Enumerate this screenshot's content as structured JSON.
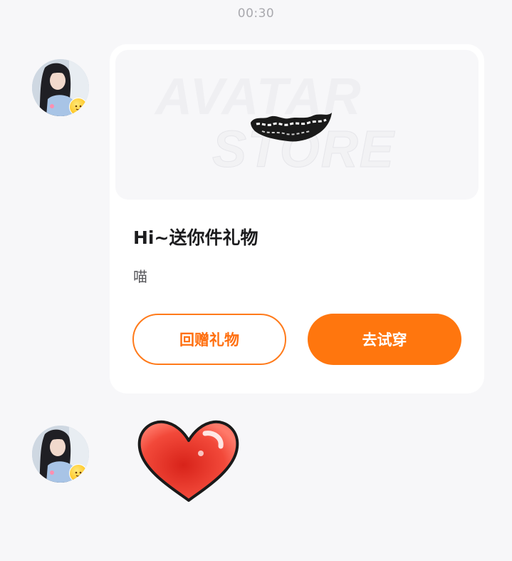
{
  "chat": {
    "timestamp": "00:30"
  },
  "gift_card": {
    "banner_watermark_line1": "AVATAR",
    "banner_watermark_line2": "STORE",
    "banner_item_icon": "mouth-teeth-accessory",
    "title": "Hi~送你件礼物",
    "subtitle": "喵",
    "return_gift_label": "回赠礼物",
    "try_on_label": "去试穿"
  },
  "messages": [
    {
      "type": "gift-card",
      "sender_avatar_icon": "user-avatar"
    },
    {
      "type": "sticker",
      "sender_avatar_icon": "user-avatar",
      "sticker_icon": "red-heart-icon"
    }
  ],
  "colors": {
    "accent": "#ff760e",
    "background": "#f7f7f9",
    "card": "#ffffff"
  }
}
